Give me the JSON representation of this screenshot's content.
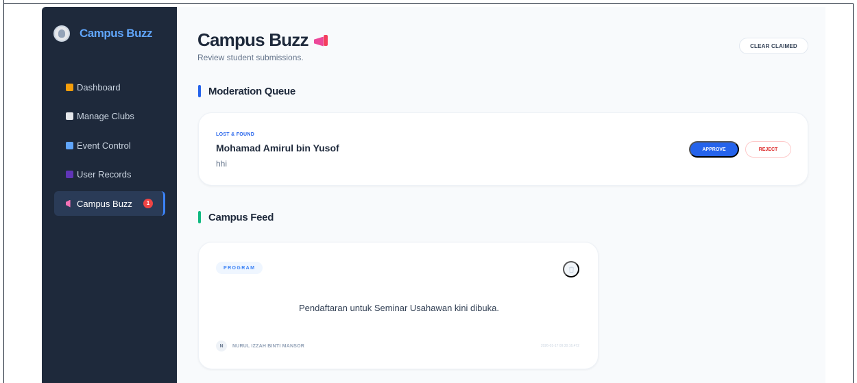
{
  "sidebar": {
    "brand": "Campus Buzz",
    "items": [
      {
        "label": "Dashboard",
        "icon": "home-icon"
      },
      {
        "label": "Manage Clubs",
        "icon": "bank-icon"
      },
      {
        "label": "Event Control",
        "icon": "calendar-icon"
      },
      {
        "label": "User Records",
        "icon": "users-icon"
      },
      {
        "label": "Campus Buzz",
        "icon": "megaphone-icon",
        "badge": "1",
        "active": true
      }
    ]
  },
  "header": {
    "title": "Campus Buzz",
    "subtitle": "Review student submissions.",
    "clear_label": "CLEAR CLAIMED"
  },
  "moderation": {
    "heading": "Moderation Queue",
    "item": {
      "category": "LOST & FOUND",
      "name": "Mohamad Amirul bin Yusof",
      "text": "hhi",
      "approve_label": "APPROVE",
      "reject_label": "REJECT"
    }
  },
  "feed": {
    "heading": "Campus Feed",
    "post": {
      "tag": "PROGRAM",
      "text": "Pendaftaran untuk Seminar Usahawan kini dibuka.",
      "author_initial": "N",
      "author": "NURUL IZZAH BINTI MANSOR",
      "timestamp": "2026-01-17 09:30:16.472"
    }
  },
  "colors": {
    "sidebar_bg": "#1e293b",
    "accent": "#2563eb",
    "feed_accent": "#10b981",
    "danger": "#dc2626"
  }
}
